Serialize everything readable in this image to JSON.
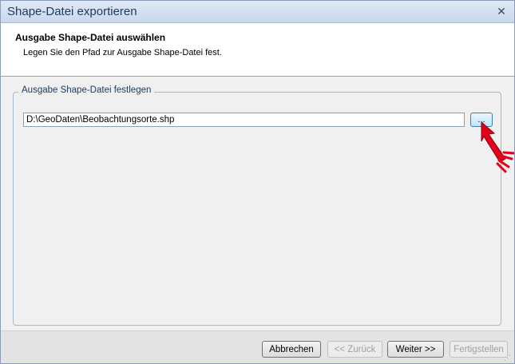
{
  "window": {
    "title": "Shape-Datei exportieren",
    "close_label": "✕"
  },
  "header": {
    "title": "Ausgabe Shape-Datei auswählen",
    "description": "Legen Sie den Pfad zur Ausgabe Shape-Datei fest."
  },
  "group": {
    "legend": "Ausgabe Shape-Datei festlegen",
    "path_value": "D:\\GeoDaten\\Beobachtungsorte.shp",
    "browse_label": "..."
  },
  "footer": {
    "buttons": [
      {
        "label": "Abbrechen",
        "enabled": true
      },
      {
        "label": "<< Zurück",
        "enabled": false
      },
      {
        "label": "Weiter >>",
        "enabled": true
      },
      {
        "label": "Fertigstellen",
        "enabled": false
      }
    ]
  },
  "colors": {
    "title_text": "#1e395b",
    "arrow": "#e3001b",
    "accent_border": "#3c7fb1"
  },
  "icons": {
    "close": "close-icon",
    "pointer": "red-arrow-pointer-icon",
    "resize": "resize-grip-icon"
  }
}
